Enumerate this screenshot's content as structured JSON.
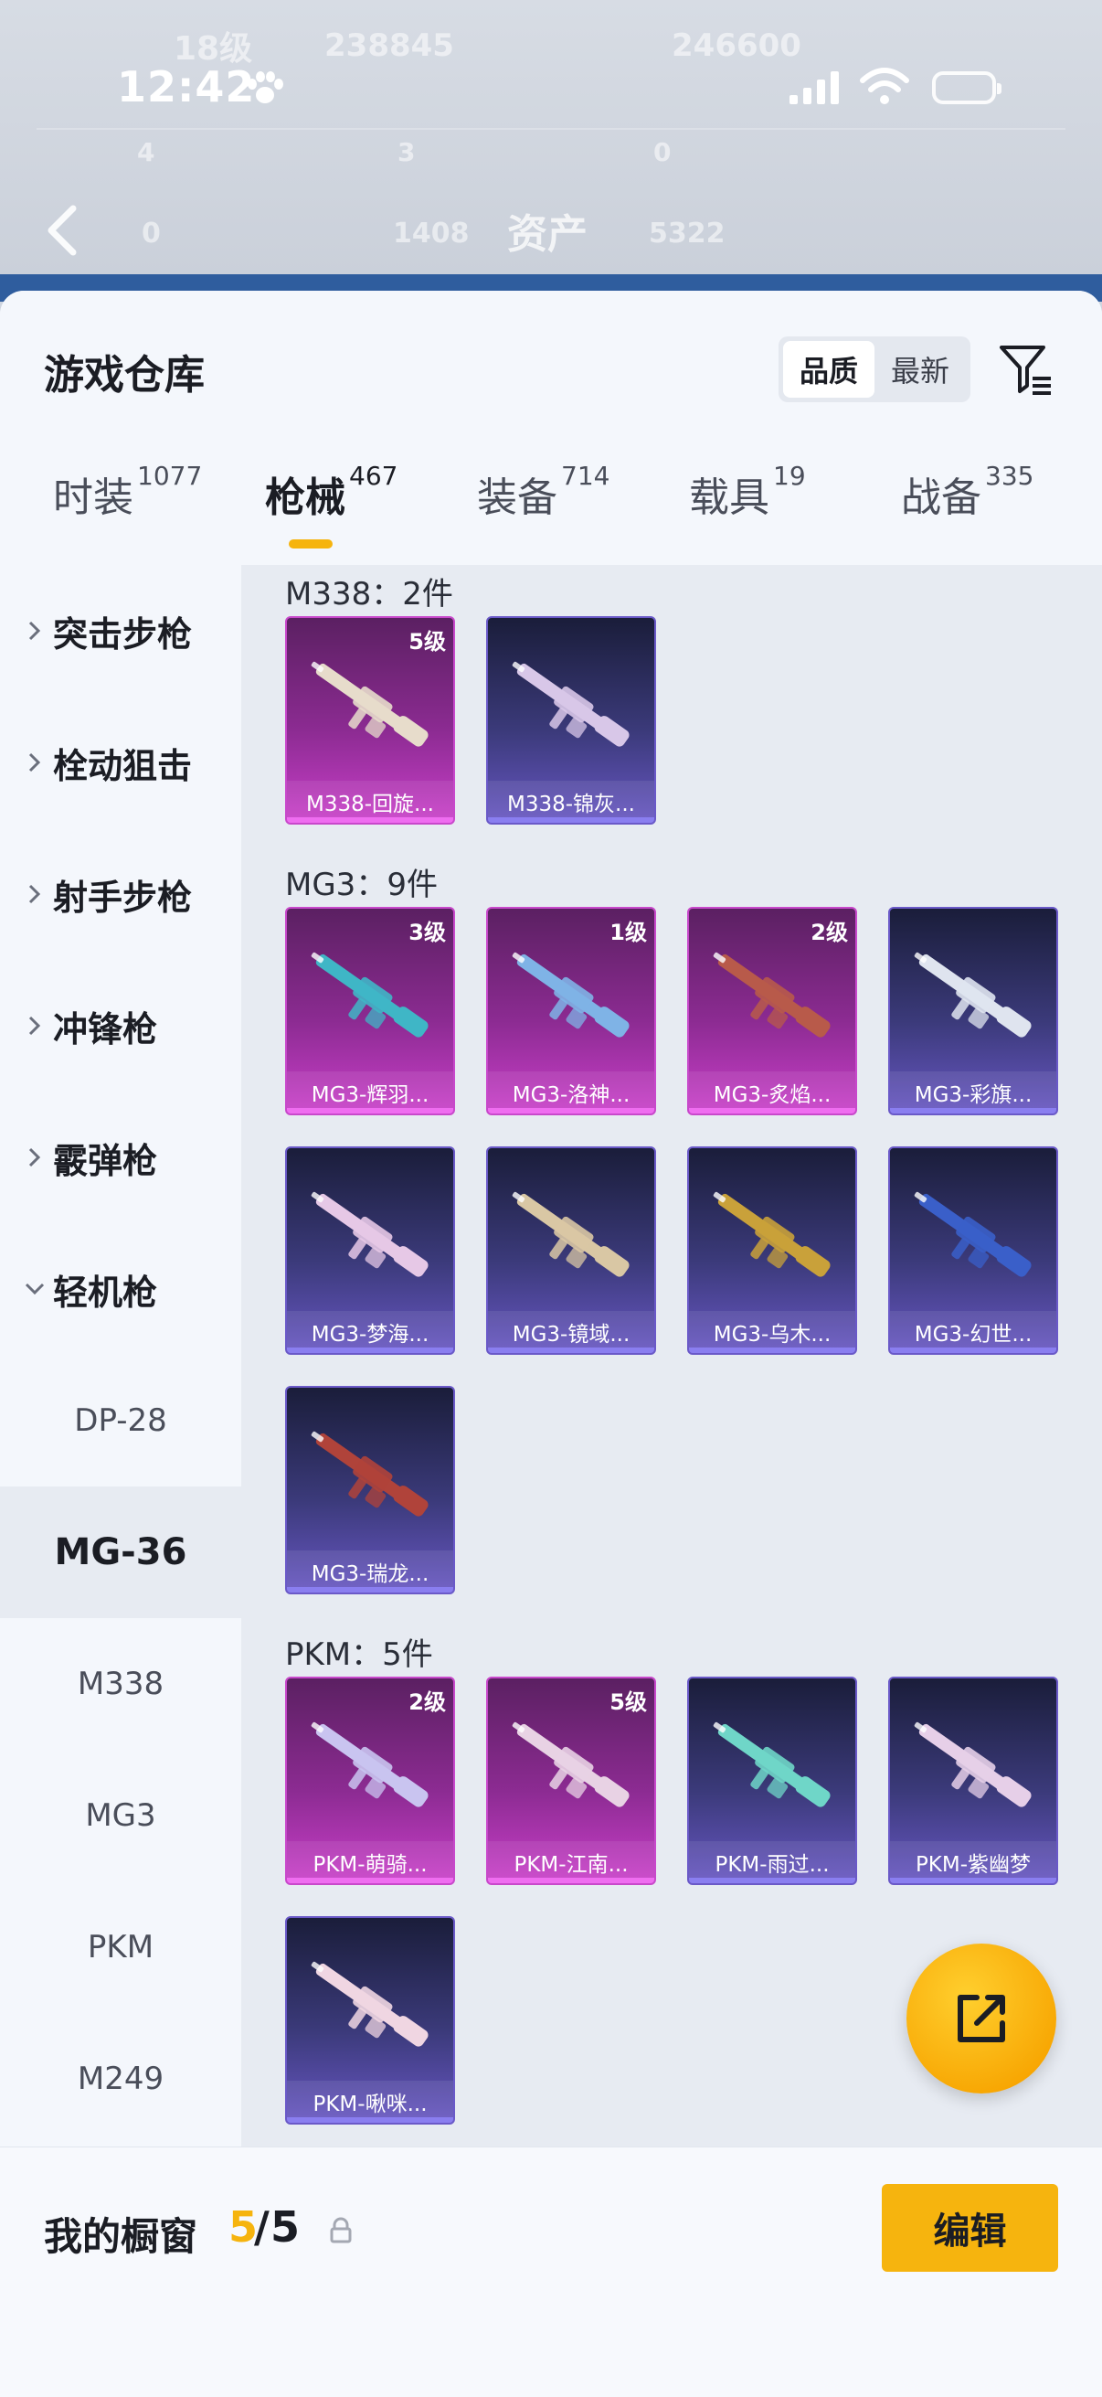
{
  "status_bar": {
    "time": "12:42"
  },
  "background": {
    "level_text": "18级",
    "value_left": "238845",
    "value_right": "246600",
    "stats_row1": [
      "4",
      "3",
      "0"
    ],
    "stats_row2": [
      "0",
      "1408",
      "5322"
    ],
    "page_title": "资产"
  },
  "header": {
    "title": "游戏仓库",
    "sort_options": [
      {
        "label": "品质",
        "active": true
      },
      {
        "label": "最新",
        "active": false
      }
    ],
    "filter_icon": "filter-icon"
  },
  "tabs": [
    {
      "label": "时装",
      "count": "1077",
      "active": false
    },
    {
      "label": "枪械",
      "count": "467",
      "active": true
    },
    {
      "label": "装备",
      "count": "714",
      "active": false
    },
    {
      "label": "载具",
      "count": "19",
      "active": false
    },
    {
      "label": "战备",
      "count": "335",
      "active": false
    }
  ],
  "sidebar": {
    "categories": [
      {
        "label": "突击步枪",
        "expanded": false
      },
      {
        "label": "栓动狙击",
        "expanded": false
      },
      {
        "label": "射手步枪",
        "expanded": false
      },
      {
        "label": "冲锋枪",
        "expanded": false
      },
      {
        "label": "霰弹枪",
        "expanded": false
      },
      {
        "label": "轻机枪",
        "expanded": true
      }
    ],
    "subitems": [
      {
        "label": "DP-28",
        "active": false
      },
      {
        "label": "MG-36",
        "active": true
      },
      {
        "label": "M338",
        "active": false
      },
      {
        "label": "MG3",
        "active": false
      },
      {
        "label": "PKM",
        "active": false
      },
      {
        "label": "M249",
        "active": false
      }
    ]
  },
  "groups": [
    {
      "title": "M338：2件",
      "items": [
        {
          "name": "M338-回旋...",
          "level": "5级",
          "rarity": "purple",
          "color": "#e7dccb"
        },
        {
          "name": "M338-锦灰...",
          "level": "",
          "rarity": "blue",
          "color": "#d8c7e8"
        }
      ]
    },
    {
      "title": "MG3：9件",
      "items": [
        {
          "name": "MG3-辉羽...",
          "level": "3级",
          "rarity": "purple",
          "color": "#3fb6c6"
        },
        {
          "name": "MG3-洛神...",
          "level": "1级",
          "rarity": "purple",
          "color": "#7fb3e6"
        },
        {
          "name": "MG3-炙焰...",
          "level": "2级",
          "rarity": "purple",
          "color": "#b85a4a"
        },
        {
          "name": "MG3-彩旗...",
          "level": "",
          "rarity": "blue",
          "color": "#dfe4ef"
        },
        {
          "name": "MG3-梦海...",
          "level": "",
          "rarity": "blue",
          "color": "#e6c8e6"
        },
        {
          "name": "MG3-镜域...",
          "level": "",
          "rarity": "blue",
          "color": "#d9c7a4"
        },
        {
          "name": "MG3-乌木...",
          "level": "",
          "rarity": "blue",
          "color": "#c9a13a"
        },
        {
          "name": "MG3-幻世...",
          "level": "",
          "rarity": "blue",
          "color": "#3a5fc9"
        },
        {
          "name": "MG3-瑞龙...",
          "level": "",
          "rarity": "blue",
          "color": "#b0433a"
        }
      ]
    },
    {
      "title": "PKM：5件",
      "items": [
        {
          "name": "PKM-萌骑...",
          "level": "2级",
          "rarity": "purple",
          "color": "#c9c4f0"
        },
        {
          "name": "PKM-江南...",
          "level": "5级",
          "rarity": "purple",
          "color": "#e8d2e4"
        },
        {
          "name": "PKM-雨过...",
          "level": "",
          "rarity": "blue",
          "color": "#6fd6c8"
        },
        {
          "name": "PKM-紫幽梦",
          "level": "",
          "rarity": "blue",
          "color": "#e6cfe8"
        },
        {
          "name": "PKM-啾咪...",
          "level": "",
          "rarity": "blue",
          "color": "#f0d6e2"
        }
      ]
    }
  ],
  "fab": {
    "icon": "share-icon"
  },
  "showcase": {
    "title": "我的橱窗",
    "used": "5",
    "slash": "/",
    "max": "5",
    "lock_icon": "lock-icon",
    "edit_label": "编辑"
  }
}
